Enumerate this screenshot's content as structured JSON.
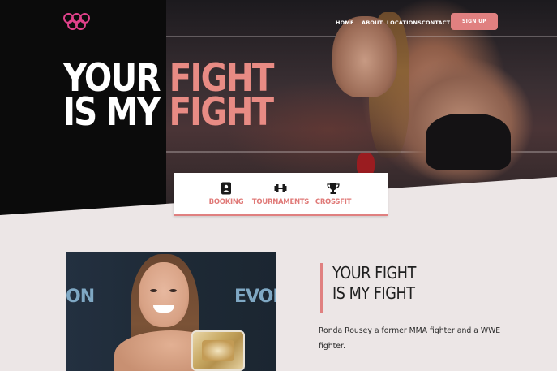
{
  "brand": {
    "logo_icon": "three-rings-logo",
    "accent": "#e08080",
    "logo_color": "#e0418a"
  },
  "nav": {
    "items": [
      {
        "label": "HOME"
      },
      {
        "label": "ABOUT"
      },
      {
        "label": "LOCATIONS"
      },
      {
        "label": "CONTACT"
      }
    ],
    "signup_label": "SIGN UP"
  },
  "hero": {
    "line1_white": "YOUR ",
    "line1_pink": "FIGHT",
    "line2_white": "IS MY ",
    "line2_pink": "FIGHT"
  },
  "services": [
    {
      "icon": "contact-book-icon",
      "label": "BOOKING"
    },
    {
      "icon": "dumbbell-icon",
      "label": "TOURNAMENTS"
    },
    {
      "icon": "trophy-icon",
      "label": "CROSSFIT"
    }
  ],
  "about": {
    "title_line1": "YOUR FIGHT",
    "title_line2": "IS MY FIGHT",
    "description": "Ronda Rousey a former MMA fighter and a WWE fighter.",
    "photo_backdrop_left": "ON",
    "photo_backdrop_right": "EVOL"
  }
}
